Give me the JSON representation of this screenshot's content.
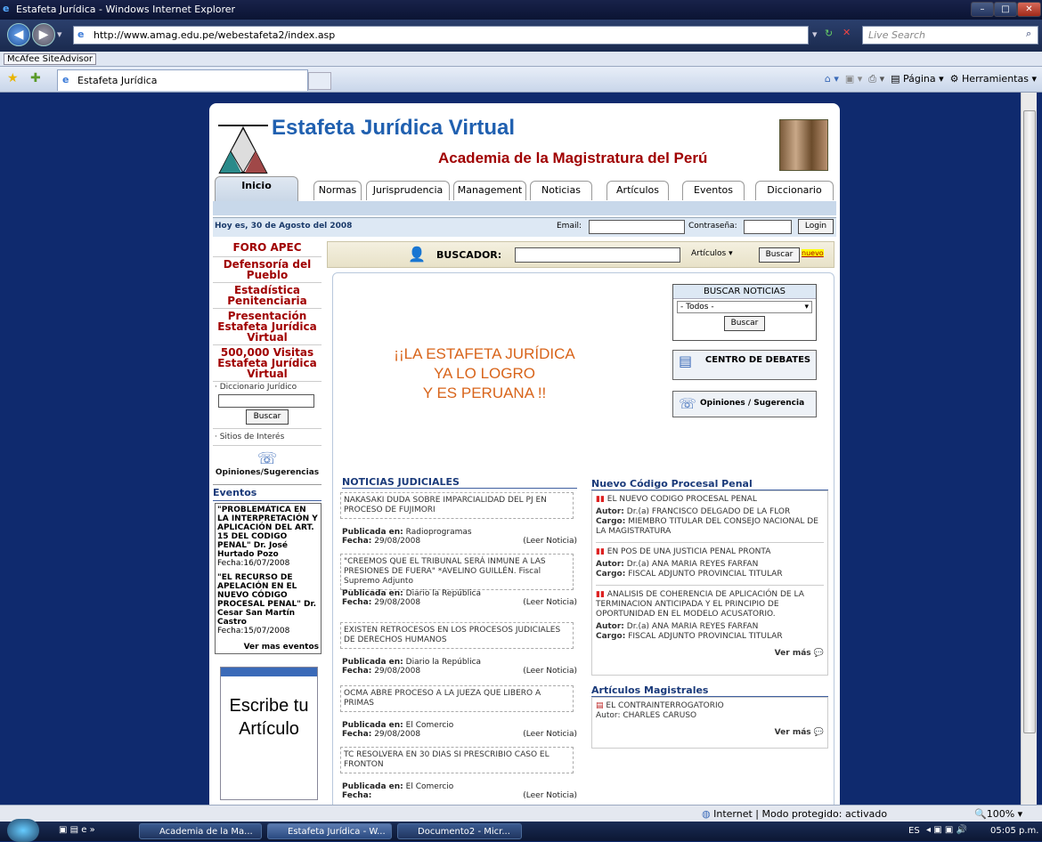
{
  "window": {
    "title": "Estafeta Jurídica - Windows Internet Explorer"
  },
  "browser": {
    "url": "http://www.amag.edu.pe/webestafeta2/index.asp",
    "search_placeholder": "Live Search",
    "toolbar_plugin": "McAfee SiteAdvisor",
    "tab_title": "Estafeta Jurídica",
    "cmd_pagina": "Página",
    "cmd_herramientas": "Herramientas"
  },
  "site": {
    "title": "Estafeta Jurídica Virtual",
    "subtitle": "Academia de la Magistratura del Perú",
    "tabs": [
      "Inicio",
      "Normas",
      "Jurisprudencia",
      "Management",
      "Noticias",
      "Artículos",
      "Eventos",
      "Diccionario"
    ],
    "date_text": "Hoy es, 30 de Agosto del 2008",
    "email_label": "Email:",
    "password_label": "Contraseña:",
    "login_label": "Login"
  },
  "sidebar": {
    "links": [
      "FORO APEC",
      "Defensoría del Pueblo",
      "Estadística Penitenciaria",
      "Presentación Estafeta Jurídica Virtual",
      "500,000 Visitas Estafeta Jurídica Virtual"
    ],
    "dict_label": "· Diccionario Jurídico",
    "buscar": "Buscar",
    "sitios": "· Sitios de Interés",
    "opiniones": "Opiniones/Sugerencias",
    "eventos_title": "Eventos",
    "eventos": [
      {
        "title": "\"PROBLEMÁTICA EN LA INTERPRETACIÓN Y APLICACIÓN DEL ART. 15 DEL CODIGO PENAL\" Dr. José Hurtado Pozo",
        "date": "Fecha:16/07/2008"
      },
      {
        "title": "\"EL RECURSO DE APELACIÓN EN EL NUEVO CÓDIGO PROCESAL PENAL\" Dr. Cesar San Martín Castro",
        "date": "Fecha:15/07/2008"
      }
    ],
    "ver_mas_eventos": "Ver mas eventos",
    "escribe": "Escribe tu Artículo"
  },
  "buscador": {
    "label": "BUSCADOR:",
    "select_value": "Artículos",
    "button": "Buscar",
    "nuevo": "nuevo"
  },
  "banner": {
    "line1": "¡¡LA ESTAFETA JURÍDICA",
    "line2": "YA LO LOGRO",
    "line3": "Y ES PERUANA !!"
  },
  "buscar_noticias": {
    "title": "BUSCAR NOTICIAS",
    "select_value": "- Todos -",
    "button": "Buscar"
  },
  "centro_debates": "CENTRO DE DEBATES",
  "opiniones_btn": "Opiniones / Sugerencia",
  "noticias": {
    "title": "NOTICIAS JUDICIALES",
    "pub_label": "Publicada en:",
    "fecha_label": "Fecha:",
    "leer": "(Leer Noticia)",
    "items": [
      {
        "headline": "NAKASAKI DUDA SOBRE IMPARCIALIDAD DEL PJ EN PROCESO DE FUJIMORI",
        "source": "Radioprogramas",
        "date": "29/08/2008"
      },
      {
        "headline": "\"CREEMOS QUE EL TRIBUNAL SERÁ INMUNE A LAS PRESIONES DE FUERA\" *AVELINO GUILLÉN. Fiscal Supremo Adjunto",
        "source": "Diario la República",
        "date": "29/08/2008"
      },
      {
        "headline": "EXISTEN RETROCESOS EN LOS PROCESOS JUDICIALES DE DERECHOS HUMANOS",
        "source": "Diario la República",
        "date": "29/08/2008"
      },
      {
        "headline": "OCMA ABRE PROCESO A LA JUEZA QUE LIBERO A PRIMAS",
        "source": "El Comercio",
        "date": "29/08/2008"
      },
      {
        "headline": "TC RESOLVERA EN 30 DIAS SI PRESCRIBIO CASO EL FRONTON",
        "source": "El Comercio",
        "date": ""
      }
    ]
  },
  "cpp": {
    "title": "Nuevo Código Procesal Penal",
    "autor_label": "Autor:",
    "cargo_label": "Cargo:",
    "items": [
      {
        "title": "EL NUEVO CODIGO PROCESAL PENAL",
        "autor": "Dr.(a) FRANCISCO DELGADO DE LA FLOR",
        "cargo": "MIEMBRO TITULAR DEL CONSEJO NACIONAL DE LA MAGISTRATURA"
      },
      {
        "title": "EN POS DE UNA JUSTICIA PENAL PRONTA",
        "autor": "Dr.(a) ANA MARIA REYES FARFAN",
        "cargo": "FISCAL ADJUNTO PROVINCIAL TITULAR"
      },
      {
        "title": "ANALISIS DE COHERENCIA DE APLICACIÓN DE LA TERMINACION ANTICIPADA Y EL PRINCIPIO DE OPORTUNIDAD EN EL MODELO ACUSATORIO.",
        "autor": "Dr.(a) ANA MARIA REYES FARFAN",
        "cargo": "FISCAL ADJUNTO PROVINCIAL TITULAR"
      }
    ],
    "ver_mas": "Ver más"
  },
  "articulos": {
    "title": "Artículos Magistrales",
    "item": "EL CONTRAINTERROGATORIO",
    "autor": "Autor: CHARLES CARUSO",
    "ver_mas": "Ver más"
  },
  "status": {
    "zone": "Internet | Modo protegido: activado",
    "zoom": "100%"
  },
  "taskbar": {
    "tasks": [
      "Academia de la Ma...",
      "Estafeta Jurídica - W...",
      "Documento2 - Micr..."
    ],
    "lang": "ES",
    "clock": "05:05 p.m."
  }
}
